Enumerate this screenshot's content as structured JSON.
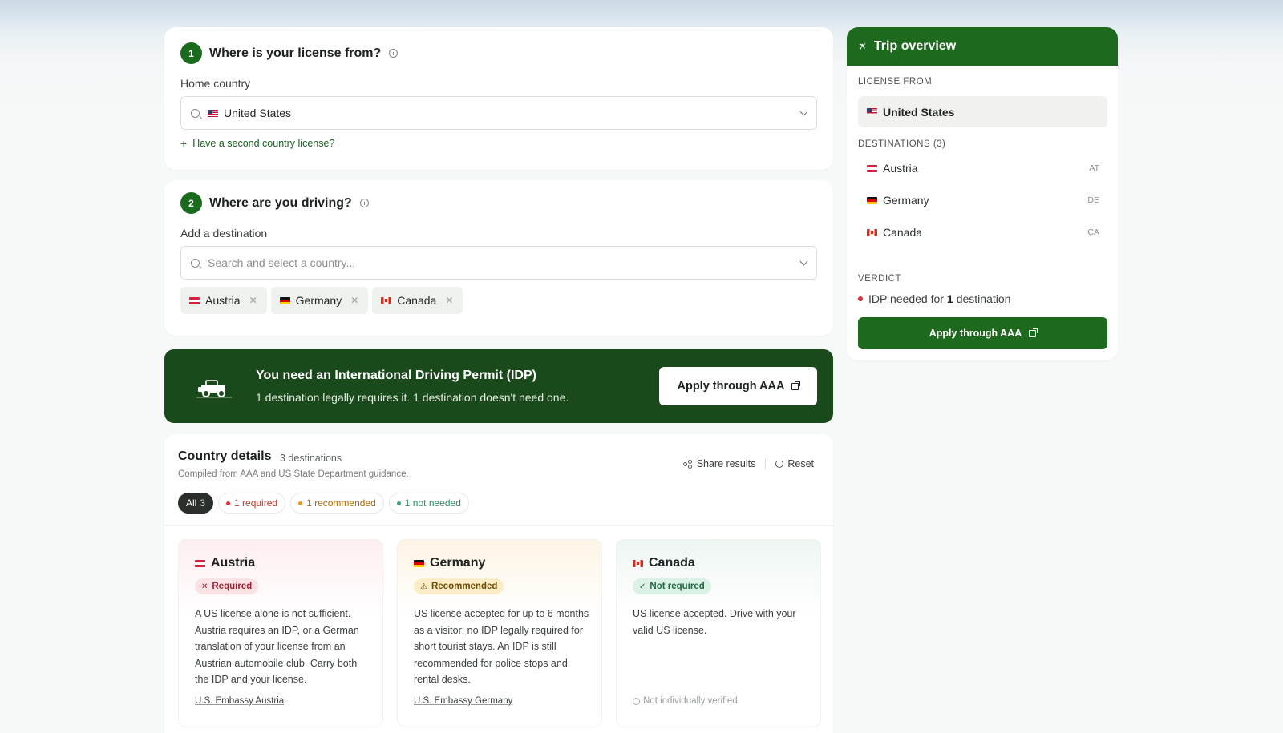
{
  "step1": {
    "number": "1",
    "title": "Where is your license from?",
    "field_label": "Home country",
    "selected_country": "United States",
    "second_license_link": "Have a second country license?"
  },
  "step2": {
    "number": "2",
    "title": "Where are you driving?",
    "field_label": "Add a destination",
    "search_placeholder": "Search and select a country...",
    "chips": [
      "Austria",
      "Germany",
      "Canada"
    ]
  },
  "banner": {
    "title": "You need an International Driving Permit (IDP)",
    "subtitle": "1 destination legally requires it. 1 destination doesn't need one.",
    "button": "Apply through AAA"
  },
  "details": {
    "title": "Country details",
    "count": "3 destinations",
    "subtitle": "Compiled from AAA and US State Department guidance.",
    "share": "Share results",
    "reset": "Reset",
    "filters": {
      "all": "All",
      "all_count": "3",
      "required": "1 required",
      "recommended": "1 recommended",
      "not_needed": "1 not needed"
    },
    "countries": [
      {
        "name": "Austria",
        "status": "Required",
        "body": "A US license alone is not sufficient. Austria requires an IDP, or a German translation of your license from an Austrian automobile club. Carry both the IDP and your license.",
        "footer": "U.S. Embassy Austria"
      },
      {
        "name": "Germany",
        "status": "Recommended",
        "body": "US license accepted for up to 6 months as a visitor; no IDP legally required for short tourist stays. An IDP is still recommended for police stops and rental desks.",
        "footer": "U.S. Embassy Germany"
      },
      {
        "name": "Canada",
        "status": "Not required",
        "body": "US license accepted. Drive with your valid US license.",
        "footer": "Not individually verified"
      }
    ]
  },
  "overview": {
    "title": "Trip overview",
    "license_label": "LICENSE FROM",
    "license_country": "United States",
    "destinations_label": "DESTINATIONS (3)",
    "destinations": [
      {
        "name": "Austria",
        "code": "AT"
      },
      {
        "name": "Germany",
        "code": "DE"
      },
      {
        "name": "Canada",
        "code": "CA"
      }
    ],
    "verdict_label": "VERDICT",
    "verdict_prefix": "IDP needed for",
    "verdict_count": "1",
    "verdict_suffix": "destination",
    "button": "Apply through AAA"
  },
  "colors": {
    "brand_green": "#1d6a1f",
    "banner_green": "#1a4a1c",
    "required_red": "#c0392b",
    "recommended_amber": "#b26a00",
    "not_needed_green": "#2f8a65"
  },
  "icons": {
    "info": "info-icon",
    "search": "search-icon",
    "chevron": "chevron-down-icon",
    "plane": "plane-icon",
    "jeep": "jeep-icon",
    "external": "external-link-icon",
    "share": "share-icon",
    "reset": "reset-icon"
  }
}
